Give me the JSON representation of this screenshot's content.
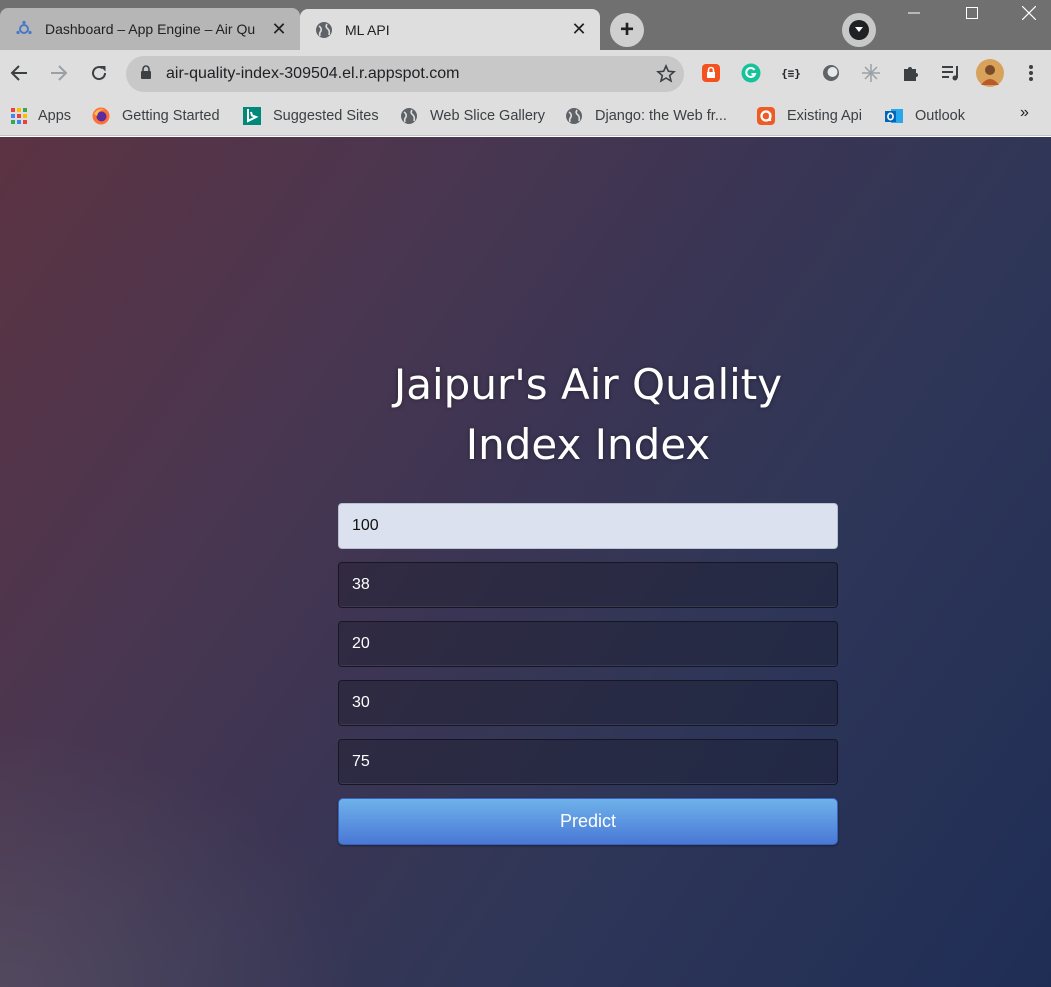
{
  "browser": {
    "tabs": [
      {
        "title": "Dashboard – App Engine – Air Qu",
        "icon": "app-engine-icon"
      },
      {
        "title": "ML API",
        "icon": "globe-icon"
      }
    ],
    "address_bar": {
      "url": "air-quality-index-309504.el.r.appspot.com"
    },
    "bookmarks": [
      {
        "label": "Apps",
        "icon": "apps-grid-icon"
      },
      {
        "label": "Getting Started",
        "icon": "firefox-icon"
      },
      {
        "label": "Suggested Sites",
        "icon": "bing-icon"
      },
      {
        "label": "Web Slice Gallery",
        "icon": "globe-icon"
      },
      {
        "label": "Django: the Web fr...",
        "icon": "globe-icon"
      },
      {
        "label": "Existing Api",
        "icon": "api-icon"
      },
      {
        "label": "Outlook",
        "icon": "outlook-icon"
      }
    ],
    "bookmarks_overflow": "»"
  },
  "page": {
    "heading_line1": "Jaipur's Air Quality",
    "heading_line2": "Index Index",
    "fields": [
      {
        "value": "100",
        "autofilled": true
      },
      {
        "value": "38"
      },
      {
        "value": "20"
      },
      {
        "value": "30"
      },
      {
        "value": "75"
      }
    ],
    "submit_label": "Predict"
  },
  "colors": {
    "accent_button": "#4a78d6",
    "page_gradient_start": "#5c3342",
    "page_gradient_end": "#1f2d55"
  }
}
